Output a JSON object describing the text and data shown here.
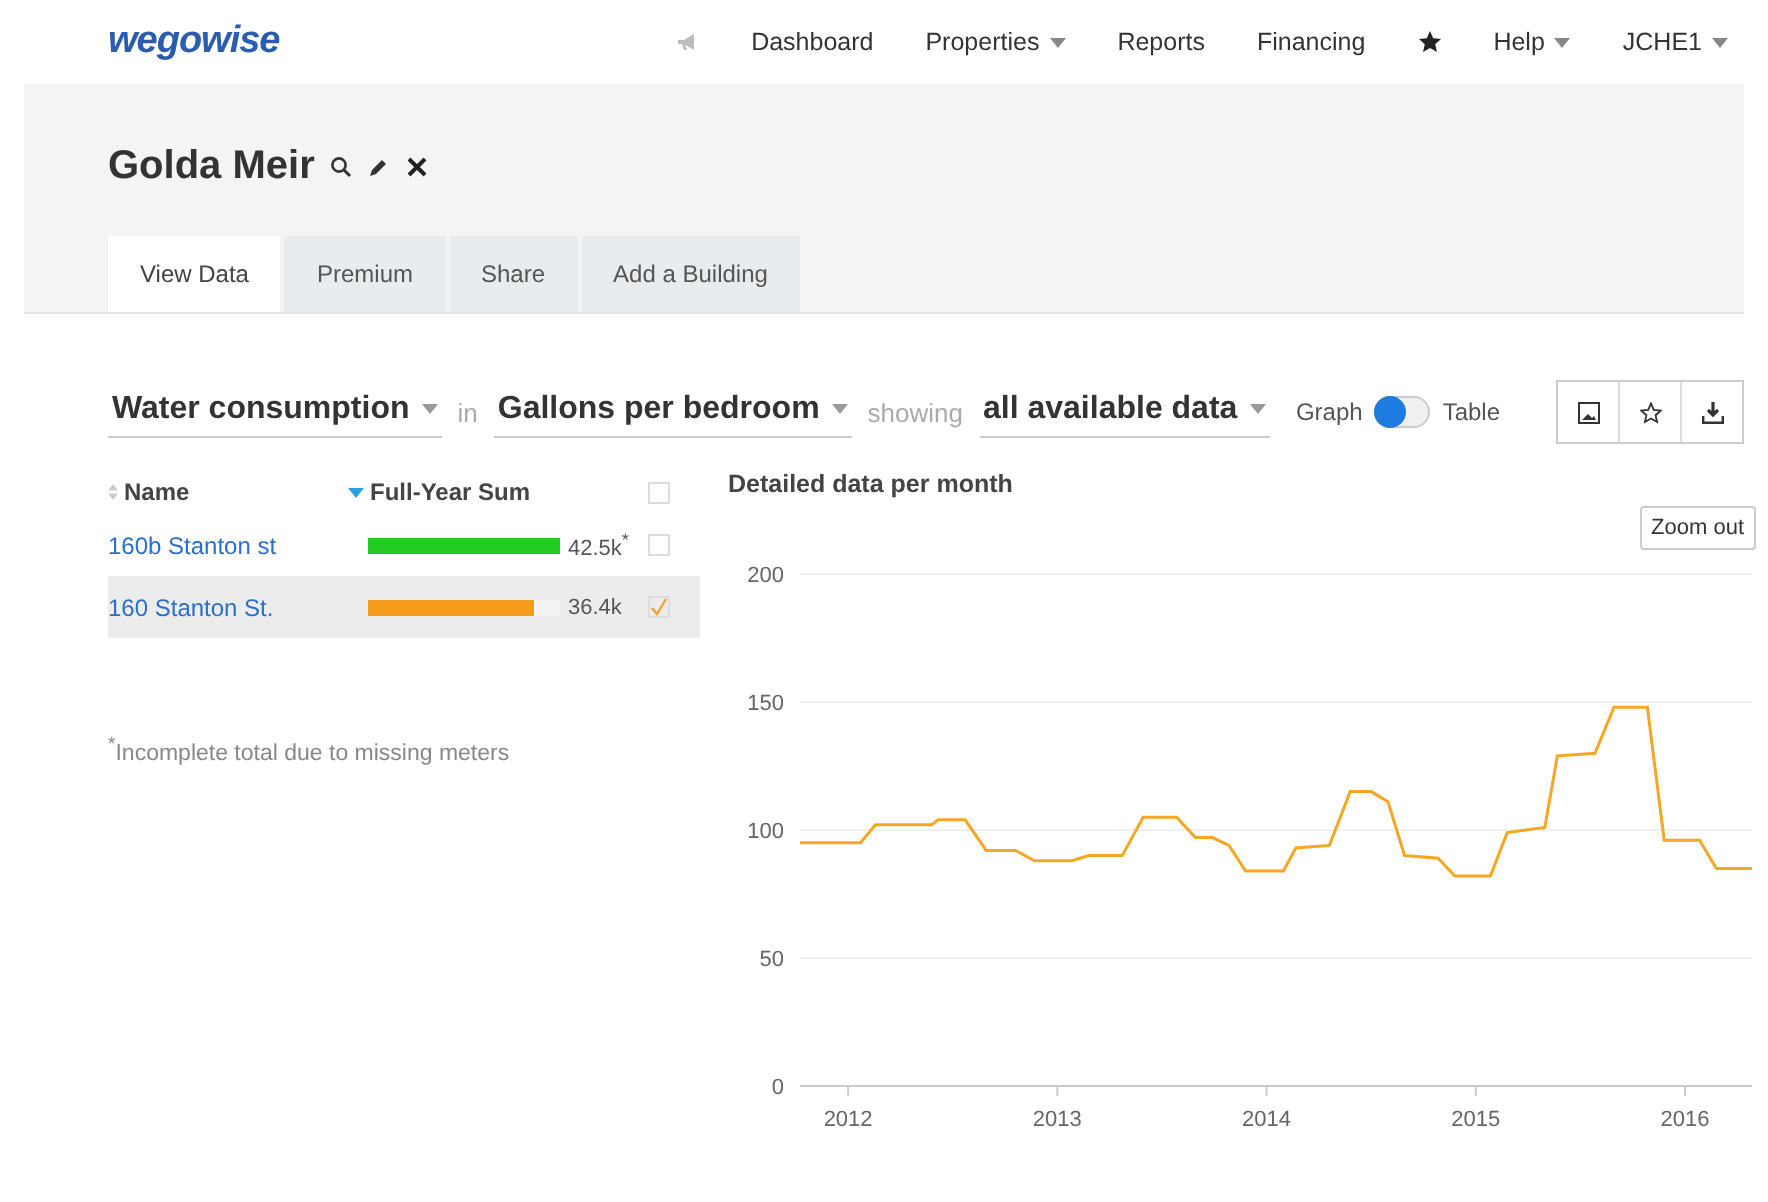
{
  "brand": "wegowise",
  "nav": [
    {
      "label": "Dashboard",
      "kind": "link"
    },
    {
      "label": "Properties",
      "kind": "menu"
    },
    {
      "label": "Reports",
      "kind": "link"
    },
    {
      "label": "Financing",
      "kind": "link"
    },
    {
      "label": "Help",
      "kind": "menu"
    },
    {
      "label": "JCHE1",
      "kind": "menu"
    }
  ],
  "title": "Golda Meir",
  "tabs": [
    {
      "label": "View Data",
      "selected": true
    },
    {
      "label": "Premium",
      "selected": false
    },
    {
      "label": "Share",
      "selected": false
    },
    {
      "label": "Add a Building",
      "selected": false
    }
  ],
  "filters": [
    {
      "kind": "dropdown",
      "label": "Water consumption"
    },
    {
      "kind": "word",
      "label": "in"
    },
    {
      "kind": "dropdown",
      "label": "Gallons per bedroom"
    },
    {
      "kind": "word",
      "label": "showing"
    },
    {
      "kind": "dropdown",
      "label": "all available data"
    }
  ],
  "view_switch": {
    "labels": [
      "Graph",
      "Table"
    ],
    "on": false
  },
  "table": {
    "columns": [
      "Name",
      "Full-Year Sum"
    ],
    "all_checked": false,
    "rows": [
      {
        "name": "160b Stanton st",
        "sum": "42.5k$^{*}$",
        "level": 1,
        "color": "#22cc22",
        "checked": false,
        "selected": false
      },
      {
        "name": "160 Stanton St.",
        "sum": "36.4k",
        "level": 0.86,
        "color": "#f59c1a",
        "checked": true,
        "selected": true
      }
    ],
    "footnote": "$^{*}$Incomplete total due to missing meters"
  },
  "chart": {
    "zoom_button": "Zoom out",
    "chart_data": {
      "type": "line",
      "title": "Detailed data per month",
      "x": [
        2011.77,
        2012.06,
        2012.13,
        2012.4,
        2012.43,
        2012.56,
        2012.66,
        2012.8,
        2012.89,
        2013.07,
        2013.15,
        2013.31,
        2013.41,
        2013.57,
        2013.66,
        2013.74,
        2013.82,
        2013.9,
        2014.08,
        2014.14,
        2014.3,
        2014.4,
        2014.5,
        2014.58,
        2014.66,
        2014.82,
        2014.9,
        2015.07,
        2015.15,
        2015.33,
        2015.39,
        2015.57,
        2015.66,
        2015.82,
        2015.9,
        2016.07,
        2016.15,
        2016.32
      ],
      "series": [
        {
          "color": "#f5a623",
          "values": [
            95,
            95,
            102,
            102,
            104,
            104,
            92,
            92,
            88,
            88,
            90,
            90,
            105,
            105,
            97,
            97,
            94,
            84,
            84,
            93,
            94,
            115,
            115,
            111,
            90,
            89,
            82,
            82,
            99,
            101,
            129,
            130,
            148,
            148,
            96,
            96,
            85,
            85
          ]
        }
      ],
      "grid": true,
      "xlim": [
        2011.77,
        2016.32
      ],
      "ylim": [
        0,
        200
      ],
      "xticks": [
        2012,
        2013,
        2014,
        2015,
        2016
      ],
      "yticks": [
        0,
        50,
        100,
        150,
        200
      ]
    }
  }
}
